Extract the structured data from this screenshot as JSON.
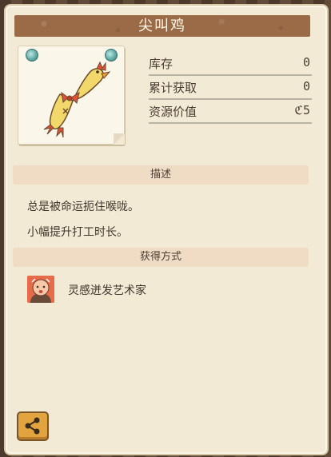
{
  "item": {
    "name": "尖叫鸡",
    "image_icon": "rubber-chicken-icon"
  },
  "stats": [
    {
      "label": "库存",
      "value": "0"
    },
    {
      "label": "累计获取",
      "value": "0"
    },
    {
      "label": "资源价值",
      "value": "ℭ5"
    }
  ],
  "description": {
    "header": "描述",
    "lines": [
      "总是被命运扼住喉咙。",
      "小幅提升打工时长。"
    ]
  },
  "acquisition": {
    "header": "获得方式",
    "sources": [
      {
        "label": "灵感迸发艺术家",
        "icon": "artist-avatar-icon"
      }
    ]
  },
  "actions": {
    "share_icon": "share-icon"
  },
  "colors": {
    "panel_bg": "#f3ead6",
    "title_bar": "#9b6b48",
    "section_header": "#f0dcc4",
    "share_button": "#e1a43e"
  }
}
